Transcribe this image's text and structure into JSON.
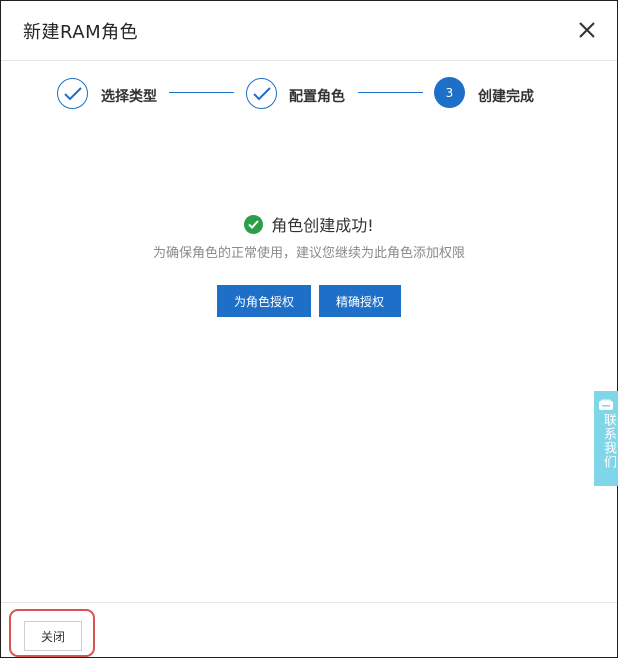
{
  "dialog": {
    "title": "新建RAM角色",
    "close_icon": "close-icon"
  },
  "steps": [
    {
      "label": "选择类型",
      "state": "done",
      "icon": "check-icon"
    },
    {
      "label": "配置角色",
      "state": "done",
      "icon": "check-icon"
    },
    {
      "label": "创建完成",
      "state": "active",
      "number": "3"
    }
  ],
  "result": {
    "icon": "check-circle-icon",
    "title": "角色创建成功!",
    "subtitle": "为确保角色的正常使用，建议您继续为此角色添加权限",
    "buttons": {
      "grant": "为角色授权",
      "fine_grant": "精确授权"
    }
  },
  "footer": {
    "close_label": "关闭"
  },
  "contact_tab": {
    "label": "联系我们",
    "icon": "message-icon"
  },
  "colors": {
    "primary": "#1e6fc8",
    "success": "#2e9d47",
    "highlight": "#d9534f",
    "contact_tab": "#7fd6e8"
  }
}
